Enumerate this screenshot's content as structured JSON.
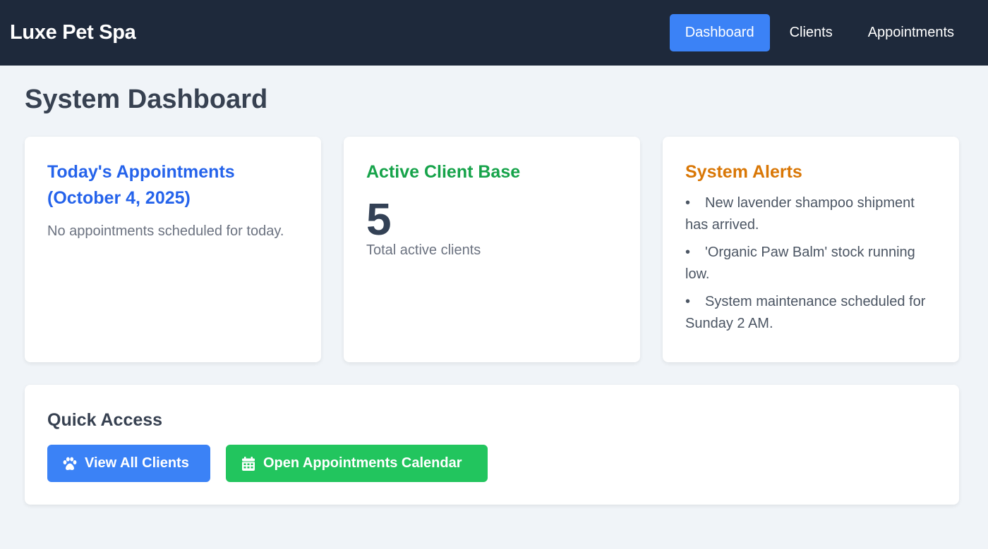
{
  "header": {
    "brand": "Luxe Pet Spa",
    "nav": [
      {
        "label": "Dashboard",
        "active": true
      },
      {
        "label": "Clients",
        "active": false
      },
      {
        "label": "Appointments",
        "active": false
      }
    ]
  },
  "page": {
    "title": "System Dashboard"
  },
  "appointments_card": {
    "title_line1": "Today's Appointments",
    "title_line2": "(October 4, 2025)",
    "message": "No appointments scheduled for today."
  },
  "clients_card": {
    "title": "Active Client Base",
    "count": "5",
    "label": "Total active clients"
  },
  "alerts_card": {
    "title": "System Alerts",
    "items": [
      "New lavender shampoo shipment has arrived.",
      "'Organic Paw Balm' stock running low.",
      "System maintenance scheduled for Sunday 2 AM."
    ]
  },
  "quick_access": {
    "title": "Quick Access",
    "buttons": [
      {
        "label": "View All Clients",
        "icon": "paw-icon"
      },
      {
        "label": "Open Appointments Calendar",
        "icon": "calendar-icon"
      }
    ]
  },
  "colors": {
    "nav_bg": "#1e293b",
    "accent_blue": "#3b82f6",
    "accent_green": "#22c55e",
    "alert_orange": "#d97706"
  }
}
